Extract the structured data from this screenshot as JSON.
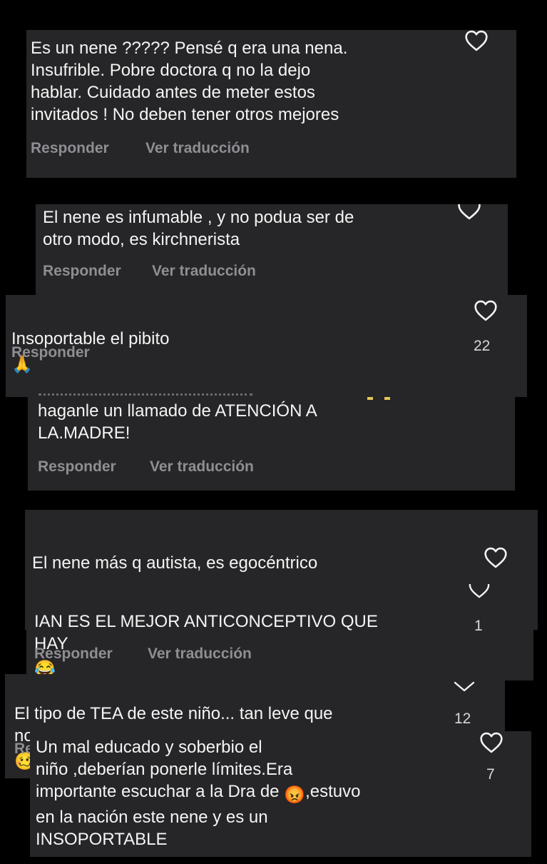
{
  "comments": [
    {
      "text": "Es un nene ????? Pensé q era una nena.\nInsufrible.  Pobre doctora q no la dejo\nhablar.  Cuidado antes de meter estos\ninvitados ! No deben tener otros mejores",
      "reply_label": "Responder",
      "translate_label": "Ver traducción"
    },
    {
      "text": "El nene es infumable , y no podua ser de\notro modo, es kirchnerista",
      "reply_label": "Responder",
      "translate_label": "Ver traducción"
    },
    {
      "text": "Insoportable el pibito",
      "emoji": "🙏",
      "reply_label": "Responder",
      "like_count": "22"
    },
    {
      "text": "haganle un llamado de ATENCIÓN A\nLA.MADRE!",
      "reply_label": "Responder",
      "translate_label": "Ver traducción"
    },
    {
      "text": "El nene más q autista, es egocéntrico"
    },
    {
      "text": "IAN ES EL MEJOR ANTICONCEPTIVO QUE\nHAY",
      "emoji": "😂",
      "like_count": "1",
      "reply_label": "Responder",
      "translate_label": "Ver traducción"
    },
    {
      "text": "El tipo de TEA de este niño... tan leve que\nno parece",
      "emoji": "🥴",
      "emoji_suffix": ".",
      "like_count": "12",
      "reply_fragment": "Re"
    },
    {
      "text_before_emoji": "Un mal educado y soberbio el\nniño ,deberían ponerle límites.Era\nimportante escuchar a la Dra de",
      "emoji": "😡",
      "text_after_emoji": ",estuvo\nen la nación este nene y es un\nINSOPORTABLE",
      "like_count": "7"
    }
  ],
  "icons": {
    "like": "heart-outline-icon",
    "expand": "chevron-down-icon"
  },
  "colors": {
    "background": "#000000",
    "card": "#262628",
    "text": "#f4f4f4",
    "action": "#8e8e93"
  }
}
